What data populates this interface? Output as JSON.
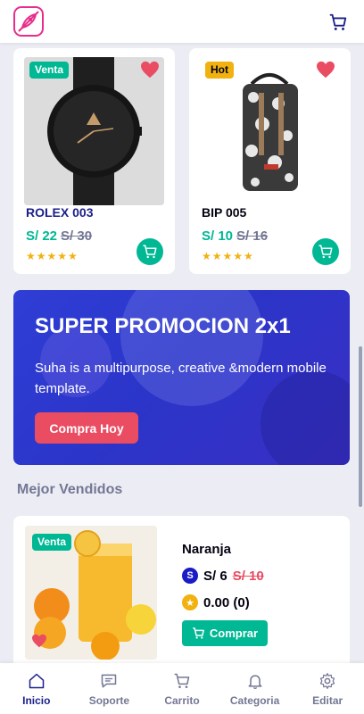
{
  "header": {
    "logo_icon": "rocket-logo-icon",
    "cart_icon": "cart-icon"
  },
  "products": [
    {
      "badge": "Venta",
      "name": "ROLEX 003",
      "price": "S/ 22",
      "old_price": "S/ 30",
      "stars": "★★★★★",
      "image": "watch-image"
    },
    {
      "badge": "Hot",
      "name": "BIP 005",
      "price": "S/ 10",
      "old_price": "S/ 16",
      "stars": "★★★★★",
      "image": "backpack-image"
    }
  ],
  "promo": {
    "title": "SUPER PROMOCION 2x1",
    "text": "Suha is a multipurpose, creative &modern mobile template.",
    "button": "Compra Hoy"
  },
  "best_sellers": {
    "title": "Mejor Vendidos",
    "item": {
      "badge": "Venta",
      "name": "Naranja",
      "price_icon": "S",
      "price": "S/ 6",
      "old_price": "S/ 10",
      "rating": "0.00 (0)",
      "button": "Comprar"
    }
  },
  "nav": [
    {
      "label": "Inicio",
      "icon": "home-icon",
      "active": true
    },
    {
      "label": "Soporte",
      "icon": "chat-icon"
    },
    {
      "label": "Carrito",
      "icon": "cart-icon"
    },
    {
      "label": "Categoria",
      "icon": "bell-icon"
    },
    {
      "label": "Editar",
      "icon": "gear-icon"
    }
  ],
  "colors": {
    "accent": "#00b894",
    "promo": "#2f3ed6",
    "danger": "#ea4c62",
    "nav_active": "#1b1f8a"
  }
}
